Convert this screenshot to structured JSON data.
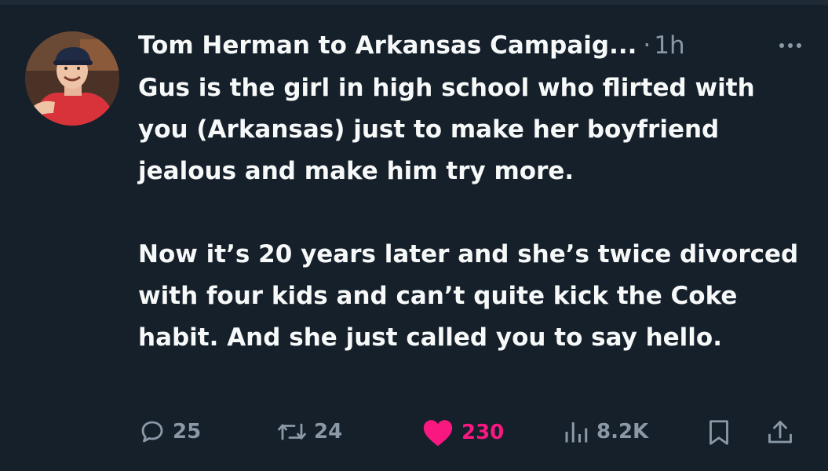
{
  "tweet": {
    "display_name": "Tom Herman to Arkansas Campaig...",
    "separator": "·",
    "timestamp": "1h",
    "paragraphs": [
      "Gus is the girl in high school who flirted with you (Arkansas) just to make her boyfriend jealous and make him try more.",
      "Now it’s 20 years later and she’s twice divorced with four kids and can’t quite kick the Coke habit. And she just called you to say hello."
    ]
  },
  "actions": {
    "reply_count": "25",
    "retweet_count": "24",
    "like_count": "230",
    "views_count": "8.2K"
  },
  "icons": {
    "more": "more-icon",
    "reply": "reply-icon",
    "retweet": "retweet-icon",
    "like": "heart-icon",
    "views": "views-icon",
    "bookmark": "bookmark-icon",
    "share": "share-icon"
  },
  "colors": {
    "background": "#15202b",
    "text": "#f7f9f9",
    "muted": "#8b98a5",
    "like_active": "#f91880"
  }
}
